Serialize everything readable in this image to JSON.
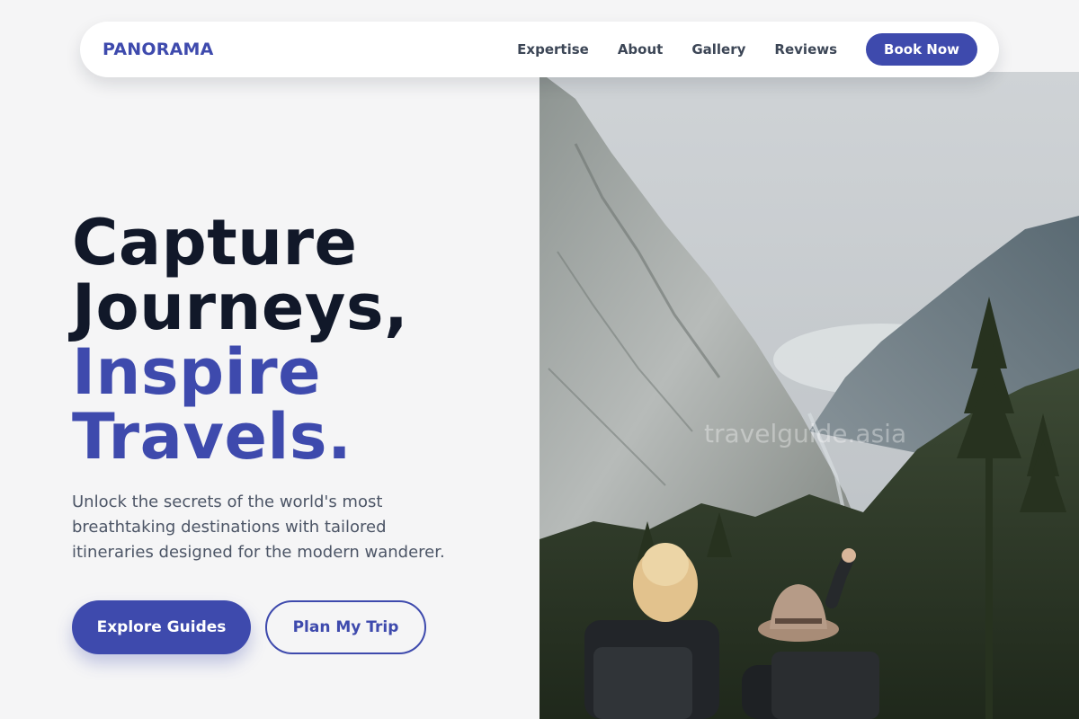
{
  "brand": {
    "name": "PANORAMA",
    "accent_color": "#3e4aad"
  },
  "nav": {
    "links": [
      "Expertise",
      "About",
      "Gallery",
      "Reviews"
    ],
    "cta": "Book Now"
  },
  "hero": {
    "headline": {
      "line1": "Capture",
      "line2": "Journeys,",
      "line3": "Inspire",
      "line4": "Travels."
    },
    "description": "Unlock the secrets of the world's most breathtaking destinations with tailored itineraries designed for the modern wanderer.",
    "primary_button": "Explore Guides",
    "secondary_button": "Plan My Trip",
    "image": {
      "subject": "Two hikers with backpacks looking at a mountain valley",
      "watermark": "travelguide.asia"
    }
  },
  "colors": {
    "background": "#f5f5f6",
    "heading": "#111829",
    "accent": "#3e4aad",
    "body_text": "#4c5566"
  }
}
